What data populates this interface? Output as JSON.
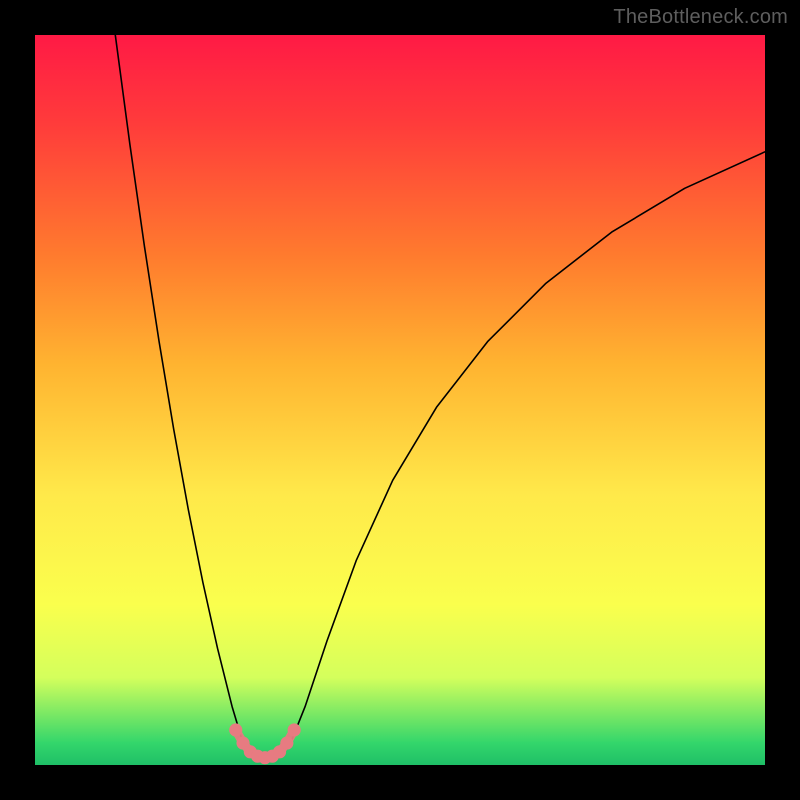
{
  "watermark": "TheBottleneck.com",
  "chart_data": {
    "type": "line",
    "title": "",
    "xlabel": "",
    "ylabel": "",
    "xlim": [
      0,
      100
    ],
    "ylim": [
      0,
      100
    ],
    "grid": false,
    "legend": false,
    "series": [
      {
        "name": "bottleneck-curve-left",
        "color": "#000000",
        "x": [
          11,
          13,
          15,
          17,
          19,
          21,
          23,
          25,
          27,
          28.5
        ],
        "y": [
          100,
          85,
          71,
          58,
          46,
          35,
          25,
          16,
          8,
          3
        ]
      },
      {
        "name": "bottleneck-curve-right",
        "color": "#000000",
        "x": [
          35,
          37,
          40,
          44,
          49,
          55,
          62,
          70,
          79,
          89,
          100
        ],
        "y": [
          3,
          8,
          17,
          28,
          39,
          49,
          58,
          66,
          73,
          79,
          84
        ]
      },
      {
        "name": "optimal-band-markers",
        "color": "#e77b81",
        "marker": "circle",
        "x": [
          27.5,
          28.5,
          29.5,
          30.5,
          31.5,
          32.5,
          33.5,
          34.5,
          35.5
        ],
        "y": [
          4.8,
          3.0,
          1.8,
          1.2,
          1.0,
          1.2,
          1.8,
          3.0,
          4.8
        ]
      }
    ],
    "notes": "V-shaped bottleneck curve over a vertical red→green gradient background. Pink dots mark the optimum trough near x≈31. Axis values are estimated from gridless plot proportions."
  }
}
